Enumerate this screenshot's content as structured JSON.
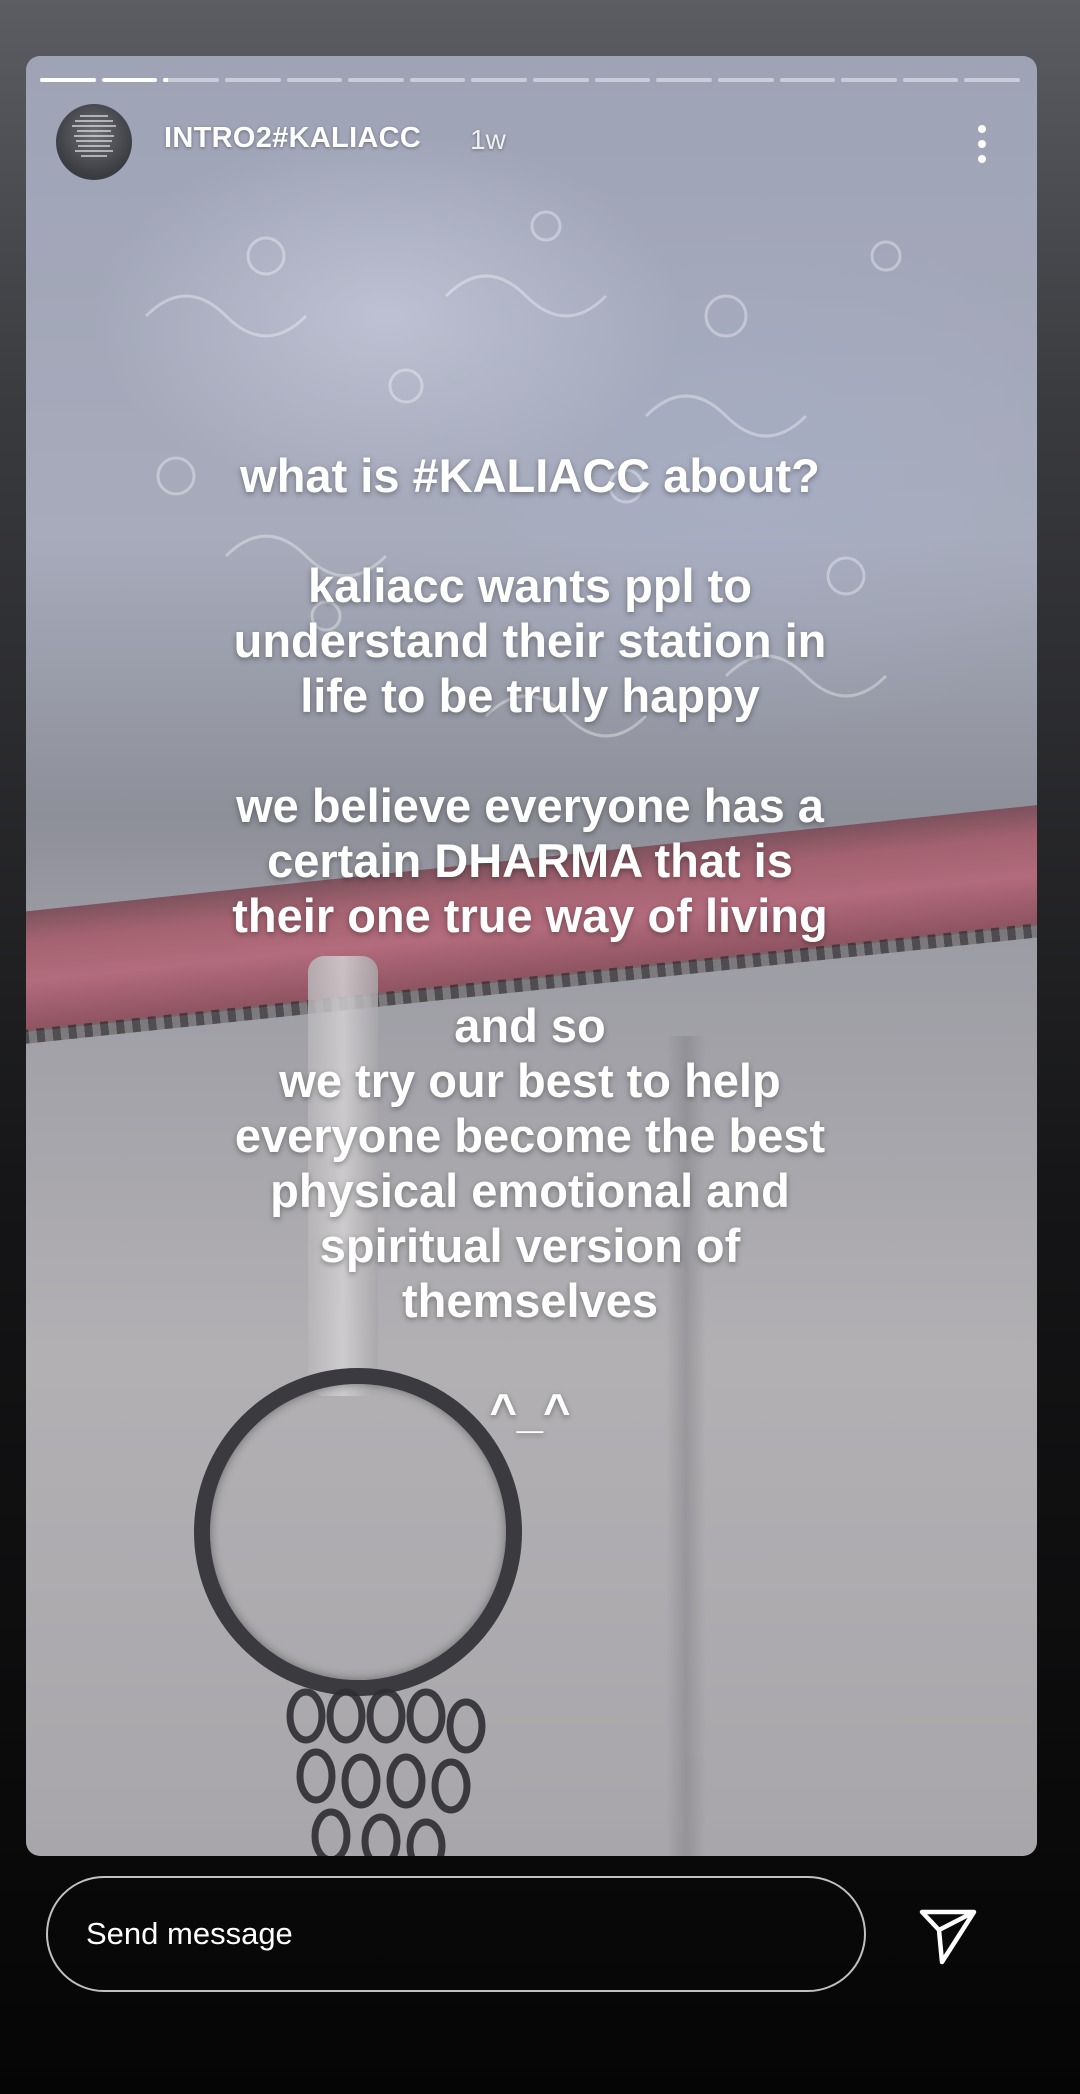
{
  "story": {
    "progress": {
      "segment_count": 16,
      "active_segment_index": 2,
      "active_segment_fill": 0.08
    },
    "header": {
      "username": "INTRO2#KALIACC",
      "time_ago": "1w",
      "avatar": "profile-avatar",
      "more_icon": "more-vertical-icon"
    },
    "text": {
      "p1": "what is #KALIACC about?",
      "p2": "kaliacc wants ppl to\nunderstand their station in\nlife to be truly happy",
      "p3": "we believe everyone has a\ncertain DHARMA that is\ntheir one true way of living",
      "p4": "and so\nwe try our best to help\neveryone become the best\nphysical emotional and\nspiritual version of\nthemselves",
      "p5": "^_^"
    }
  },
  "footer": {
    "message_placeholder": "Send message",
    "send_icon": "send-icon"
  }
}
